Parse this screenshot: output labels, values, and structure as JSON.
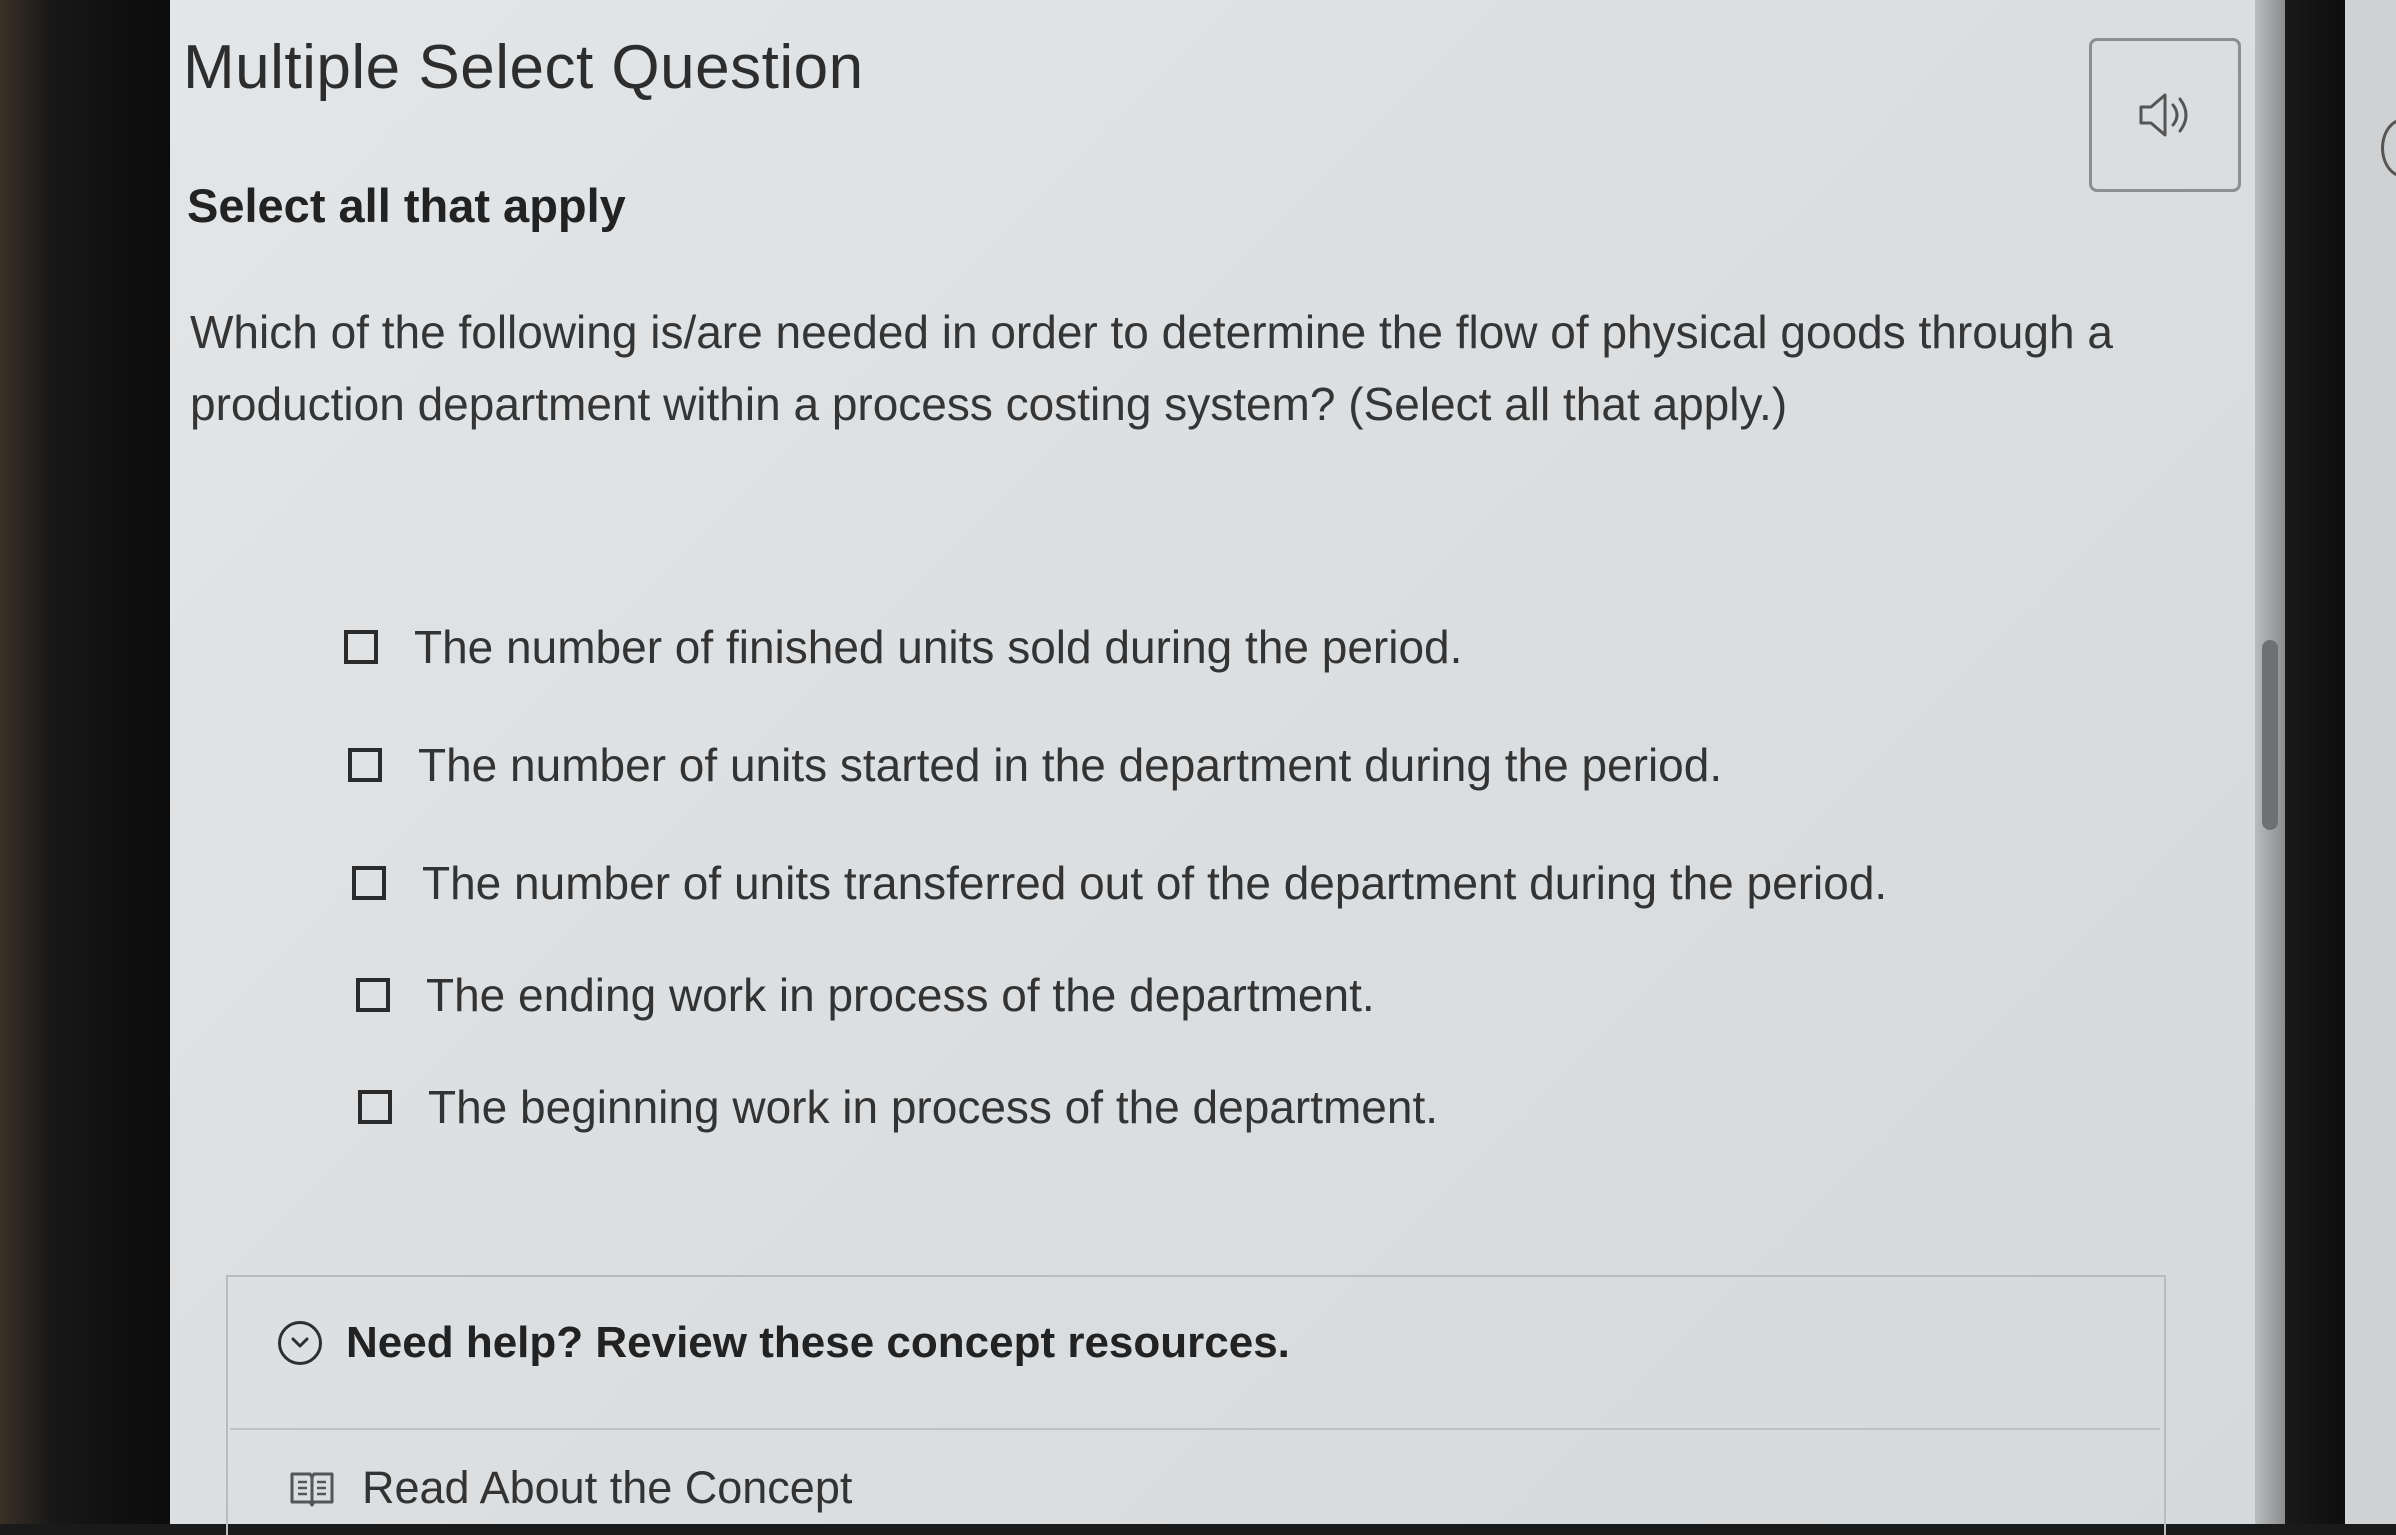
{
  "header": {
    "title": "Multiple Select Question"
  },
  "audio": {
    "icon": "speaker-icon"
  },
  "instruction": "Select all that apply",
  "question": "Which of the following is/are needed in order to determine the flow of physical goods through a production department within a process costing system? (Select all that apply.)",
  "options": [
    {
      "label": "The number of finished units sold during the period.",
      "checked": false
    },
    {
      "label": "The number of units started in the department during the period.",
      "checked": false
    },
    {
      "label": "The number of units transferred out of the department during the period.",
      "checked": false
    },
    {
      "label": "The ending work in process of the department.",
      "checked": false
    },
    {
      "label": "The beginning work in process of the department.",
      "checked": false
    }
  ],
  "help": {
    "toggle_label": "Need help? Review these concept resources.",
    "resource_label": "Read About the Concept",
    "toggle_icon": "chevron-down-icon",
    "resource_icon": "book-icon"
  }
}
